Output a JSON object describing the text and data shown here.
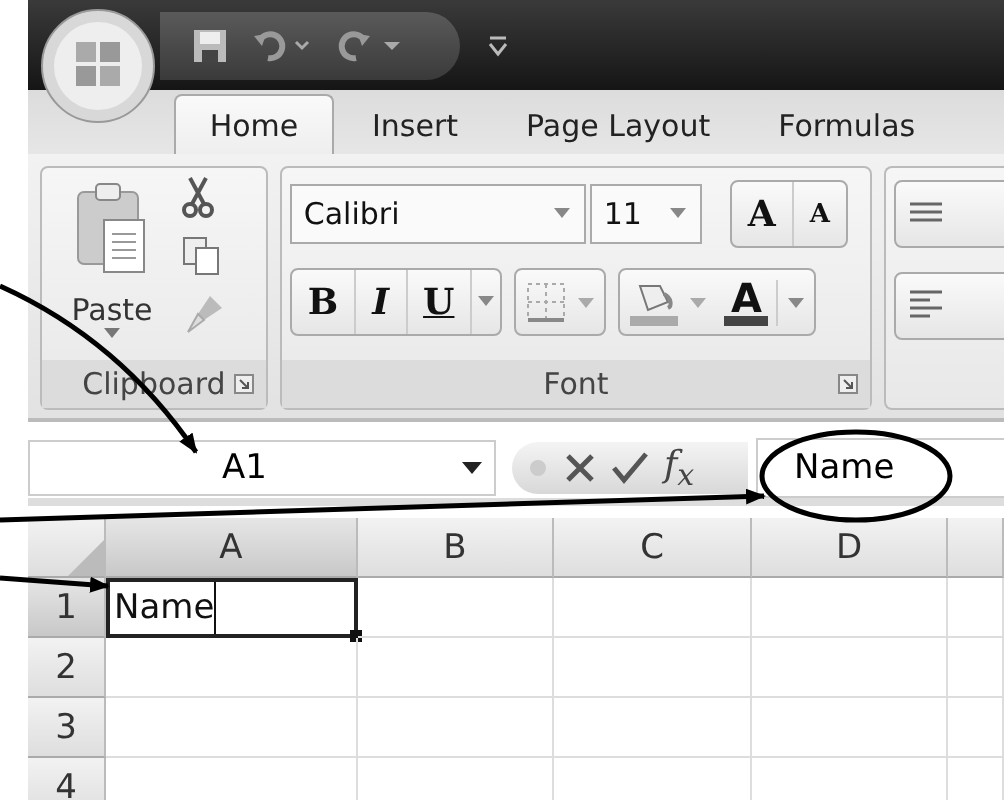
{
  "tabs": [
    {
      "label": "Home",
      "selected": true
    },
    {
      "label": "Insert",
      "selected": false
    },
    {
      "label": "Page Layout",
      "selected": false
    },
    {
      "label": "Formulas",
      "selected": false
    }
  ],
  "ribbon": {
    "clipboard": {
      "paste_label": "Paste",
      "group_label": "Clipboard"
    },
    "font": {
      "font_name": "Calibri",
      "font_size": "11",
      "grow_label": "A",
      "shrink_label": "A",
      "bold_label": "B",
      "italic_label": "I",
      "underline_label": "U",
      "font_color_label": "A",
      "group_label": "Font"
    }
  },
  "formula_bar": {
    "name_box": "A1",
    "function_label": "f$_{x}$",
    "value": "Name"
  },
  "sheet": {
    "columns": [
      "A",
      "B",
      "C",
      "D"
    ],
    "rows": [
      {
        "header": "1",
        "cells": [
          {
            "value": "Name",
            "selected": true
          },
          {
            "selected": false
          },
          {
            "selected": false
          },
          {
            "selected": false
          }
        ]
      },
      {
        "header": "2",
        "cells": [
          {
            "selected": false
          },
          {
            "selected": false
          },
          {
            "selected": false
          },
          {
            "selected": false
          }
        ]
      },
      {
        "header": "3",
        "cells": [
          {
            "selected": false
          },
          {
            "selected": false
          },
          {
            "selected": false
          },
          {
            "selected": false
          }
        ]
      },
      {
        "header": "4",
        "cells": [
          {
            "selected": false
          },
          {
            "selected": false
          },
          {
            "selected": false
          },
          {
            "selected": false
          }
        ]
      }
    ]
  }
}
